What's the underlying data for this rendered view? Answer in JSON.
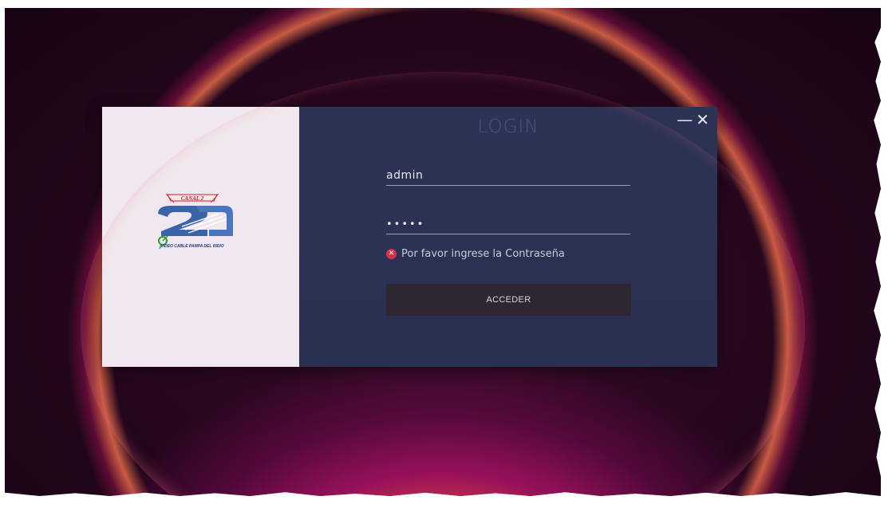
{
  "login": {
    "title": "LOGIN",
    "minimize_label": "—",
    "close_label": "✕",
    "username_value": "admin",
    "password_value": "•••••",
    "error_message": "Por favor ingrese la Contraseña",
    "submit_label": "ACCEDER"
  },
  "logo": {
    "brand": "CANAL 2",
    "caption": "VIDEO CABLE PAMPA DEL INDIO"
  },
  "icons": {
    "error": "error-x-icon",
    "minimize": "minimize-icon",
    "close": "close-icon"
  },
  "colors": {
    "form_background": "#2d3355",
    "logo_background": "#f0e8ee",
    "button_background": "#2e2630",
    "error_icon": "#d8304a",
    "logo_blue": "#3b63a8",
    "logo_red": "#c41e2a"
  }
}
